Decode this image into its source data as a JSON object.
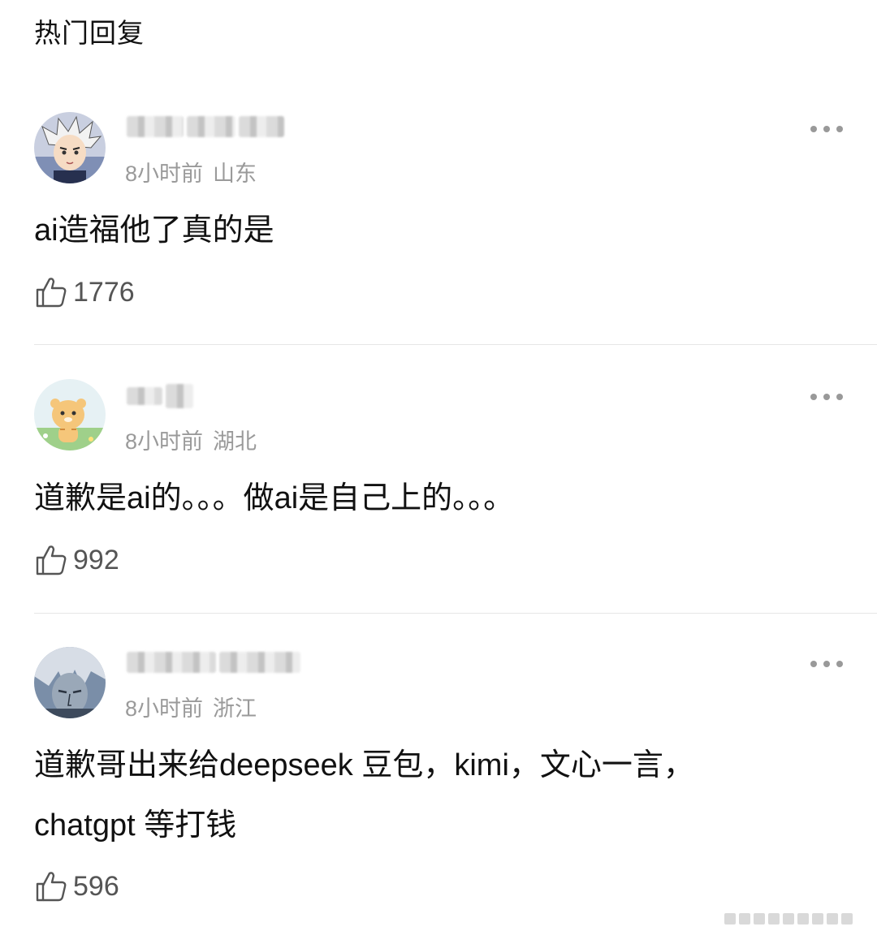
{
  "section_title": "热门回复",
  "comments": [
    {
      "time": "8小时前",
      "location": "山东",
      "text": "ai造福他了真的是",
      "likes": "1776",
      "avatar_icon": "anime-character-avatar-icon"
    },
    {
      "time": "8小时前",
      "location": "湖北",
      "text": "道歉是ai的。。。做ai是自己上的。。。",
      "likes": "992",
      "avatar_icon": "cartoon-tiger-avatar-icon"
    },
    {
      "time": "8小时前",
      "location": "浙江",
      "text_line1": "道歉哥出来给deepseek 豆包，kimi，文心一言，",
      "text_line2": "chatgpt 等打钱",
      "likes": "596",
      "avatar_icon": "anime-silver-hair-avatar-icon"
    }
  ],
  "colors": {
    "meta": "#9a9a9a",
    "divider": "#e6e6e6",
    "like_count": "#555555"
  }
}
